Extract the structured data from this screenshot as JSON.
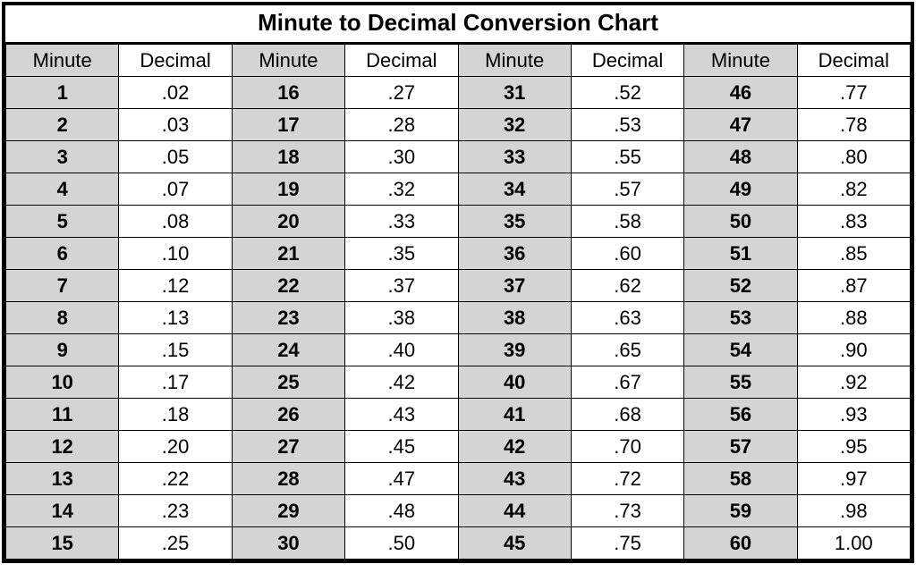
{
  "title": "Minute to Decimal Conversion Chart",
  "headers": {
    "minute": "Minute",
    "decimal": "Decimal"
  },
  "columns": [
    [
      {
        "minute": "1",
        "decimal": ".02"
      },
      {
        "minute": "2",
        "decimal": ".03"
      },
      {
        "minute": "3",
        "decimal": ".05"
      },
      {
        "minute": "4",
        "decimal": ".07"
      },
      {
        "minute": "5",
        "decimal": ".08"
      },
      {
        "minute": "6",
        "decimal": ".10"
      },
      {
        "minute": "7",
        "decimal": ".12"
      },
      {
        "minute": "8",
        "decimal": ".13"
      },
      {
        "minute": "9",
        "decimal": ".15"
      },
      {
        "minute": "10",
        "decimal": ".17"
      },
      {
        "minute": "11",
        "decimal": ".18"
      },
      {
        "minute": "12",
        "decimal": ".20"
      },
      {
        "minute": "13",
        "decimal": ".22"
      },
      {
        "minute": "14",
        "decimal": ".23"
      },
      {
        "minute": "15",
        "decimal": ".25"
      }
    ],
    [
      {
        "minute": "16",
        "decimal": ".27"
      },
      {
        "minute": "17",
        "decimal": ".28"
      },
      {
        "minute": "18",
        "decimal": ".30"
      },
      {
        "minute": "19",
        "decimal": ".32"
      },
      {
        "minute": "20",
        "decimal": ".33"
      },
      {
        "minute": "21",
        "decimal": ".35"
      },
      {
        "minute": "22",
        "decimal": ".37"
      },
      {
        "minute": "23",
        "decimal": ".38"
      },
      {
        "minute": "24",
        "decimal": ".40"
      },
      {
        "minute": "25",
        "decimal": ".42"
      },
      {
        "minute": "26",
        "decimal": ".43"
      },
      {
        "minute": "27",
        "decimal": ".45"
      },
      {
        "minute": "28",
        "decimal": ".47"
      },
      {
        "minute": "29",
        "decimal": ".48"
      },
      {
        "minute": "30",
        "decimal": ".50"
      }
    ],
    [
      {
        "minute": "31",
        "decimal": ".52"
      },
      {
        "minute": "32",
        "decimal": ".53"
      },
      {
        "minute": "33",
        "decimal": ".55"
      },
      {
        "minute": "34",
        "decimal": ".57"
      },
      {
        "minute": "35",
        "decimal": ".58"
      },
      {
        "minute": "36",
        "decimal": ".60"
      },
      {
        "minute": "37",
        "decimal": ".62"
      },
      {
        "minute": "38",
        "decimal": ".63"
      },
      {
        "minute": "39",
        "decimal": ".65"
      },
      {
        "minute": "40",
        "decimal": ".67"
      },
      {
        "minute": "41",
        "decimal": ".68"
      },
      {
        "minute": "42",
        "decimal": ".70"
      },
      {
        "minute": "43",
        "decimal": ".72"
      },
      {
        "minute": "44",
        "decimal": ".73"
      },
      {
        "minute": "45",
        "decimal": ".75"
      }
    ],
    [
      {
        "minute": "46",
        "decimal": ".77"
      },
      {
        "minute": "47",
        "decimal": ".78"
      },
      {
        "minute": "48",
        "decimal": ".80"
      },
      {
        "minute": "49",
        "decimal": ".82"
      },
      {
        "minute": "50",
        "decimal": ".83"
      },
      {
        "minute": "51",
        "decimal": ".85"
      },
      {
        "minute": "52",
        "decimal": ".87"
      },
      {
        "minute": "53",
        "decimal": ".88"
      },
      {
        "minute": "54",
        "decimal": ".90"
      },
      {
        "minute": "55",
        "decimal": ".92"
      },
      {
        "minute": "56",
        "decimal": ".93"
      },
      {
        "minute": "57",
        "decimal": ".95"
      },
      {
        "minute": "58",
        "decimal": ".97"
      },
      {
        "minute": "59",
        "decimal": ".98"
      },
      {
        "minute": "60",
        "decimal": "1.00"
      }
    ]
  ],
  "chart_data": {
    "type": "table",
    "title": "Minute to Decimal Conversion Chart",
    "column_headers": [
      "Minute",
      "Decimal",
      "Minute",
      "Decimal",
      "Minute",
      "Decimal",
      "Minute",
      "Decimal"
    ],
    "rows": [
      [
        1,
        0.02,
        16,
        0.27,
        31,
        0.52,
        46,
        0.77
      ],
      [
        2,
        0.03,
        17,
        0.28,
        32,
        0.53,
        47,
        0.78
      ],
      [
        3,
        0.05,
        18,
        0.3,
        33,
        0.55,
        48,
        0.8
      ],
      [
        4,
        0.07,
        19,
        0.32,
        34,
        0.57,
        49,
        0.82
      ],
      [
        5,
        0.08,
        20,
        0.33,
        35,
        0.58,
        50,
        0.83
      ],
      [
        6,
        0.1,
        21,
        0.35,
        36,
        0.6,
        51,
        0.85
      ],
      [
        7,
        0.12,
        22,
        0.37,
        37,
        0.62,
        52,
        0.87
      ],
      [
        8,
        0.13,
        23,
        0.38,
        38,
        0.63,
        53,
        0.88
      ],
      [
        9,
        0.15,
        24,
        0.4,
        39,
        0.65,
        54,
        0.9
      ],
      [
        10,
        0.17,
        25,
        0.42,
        40,
        0.67,
        55,
        0.92
      ],
      [
        11,
        0.18,
        26,
        0.43,
        41,
        0.68,
        56,
        0.93
      ],
      [
        12,
        0.2,
        27,
        0.45,
        42,
        0.7,
        57,
        0.95
      ],
      [
        13,
        0.22,
        28,
        0.47,
        43,
        0.72,
        58,
        0.97
      ],
      [
        14,
        0.23,
        29,
        0.48,
        44,
        0.73,
        59,
        0.98
      ],
      [
        15,
        0.25,
        30,
        0.5,
        45,
        0.75,
        60,
        1.0
      ]
    ]
  }
}
